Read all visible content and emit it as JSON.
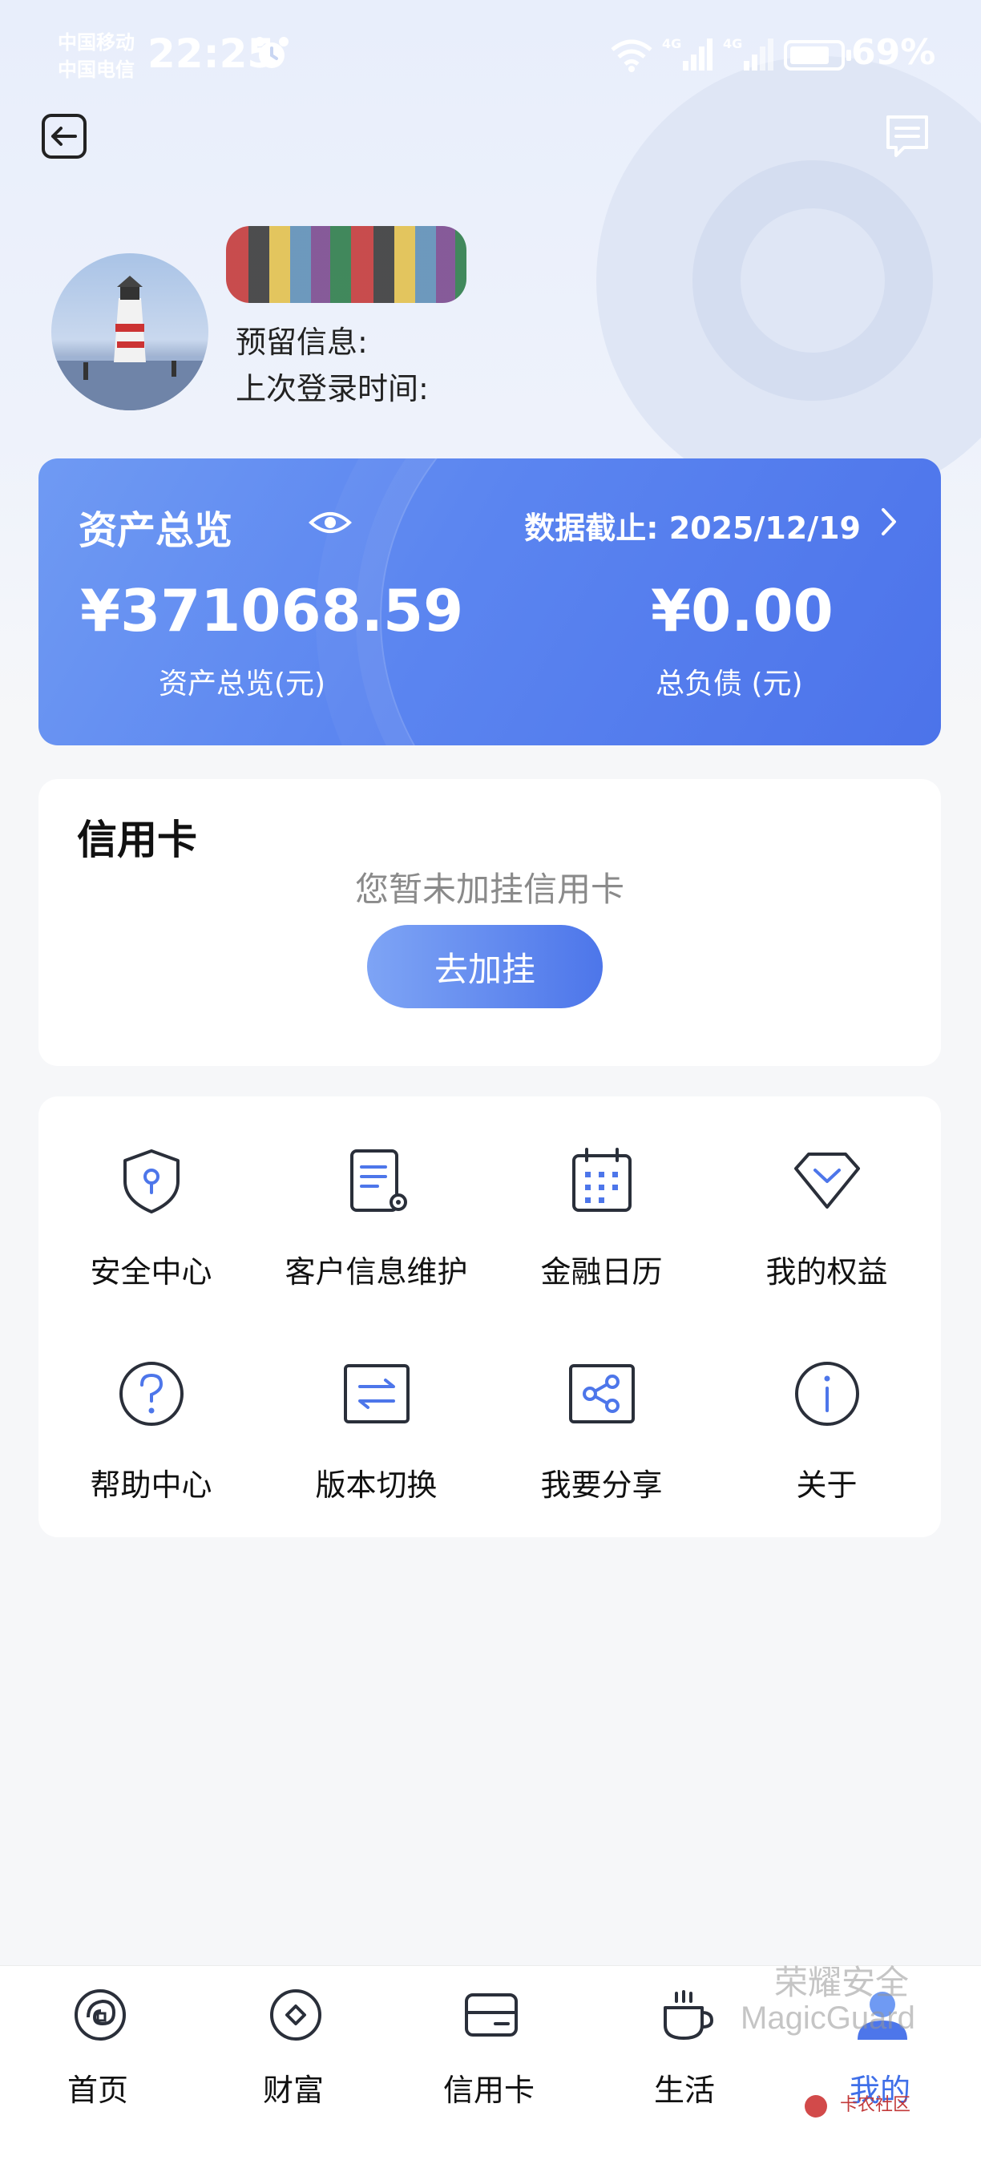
{
  "status_bar": {
    "carrier_1": "中国移动",
    "carrier_2": "中国电信",
    "time": "22:25",
    "battery": "69%",
    "signal_1_label": "4G",
    "signal_2_label": "4G"
  },
  "user": {
    "reserved_info_label": "预留信息:",
    "last_login_label": "上次登录时间:"
  },
  "assets": {
    "title": "资产总览",
    "data_as_of": "数据截止: 2025/12/19",
    "total_assets": "¥371068.59",
    "total_assets_label": "资产总览(元)",
    "total_debt": "¥0.00",
    "total_debt_label": "总负债 (元)"
  },
  "credit_card": {
    "title": "信用卡",
    "empty_text": "您暂未加挂信用卡",
    "add_button": "去加挂"
  },
  "menu": [
    {
      "label": "安全中心",
      "icon": "shield-icon"
    },
    {
      "label": "客户信息维护",
      "icon": "document-gear-icon"
    },
    {
      "label": "金融日历",
      "icon": "calendar-icon"
    },
    {
      "label": "我的权益",
      "icon": "gem-icon"
    },
    {
      "label": "帮助中心",
      "icon": "help-icon"
    },
    {
      "label": "版本切换",
      "icon": "switch-icon"
    },
    {
      "label": "我要分享",
      "icon": "share-icon"
    },
    {
      "label": "关于",
      "icon": "info-icon"
    }
  ],
  "bottom_nav": [
    {
      "label": "首页",
      "icon": "home-icon"
    },
    {
      "label": "财富",
      "icon": "wealth-icon"
    },
    {
      "label": "信用卡",
      "icon": "credit-card-icon"
    },
    {
      "label": "生活",
      "icon": "cup-icon"
    },
    {
      "label": "我的",
      "icon": "user-icon",
      "active": true
    }
  ],
  "watermarks": {
    "honor": "荣耀安全",
    "magicguard": "MagicGuard",
    "forum": "卡农社区"
  },
  "colors": {
    "accent": "#4d76ea",
    "card_gradient_start": "#6f9af3",
    "card_gradient_end": "#4c73ea"
  }
}
